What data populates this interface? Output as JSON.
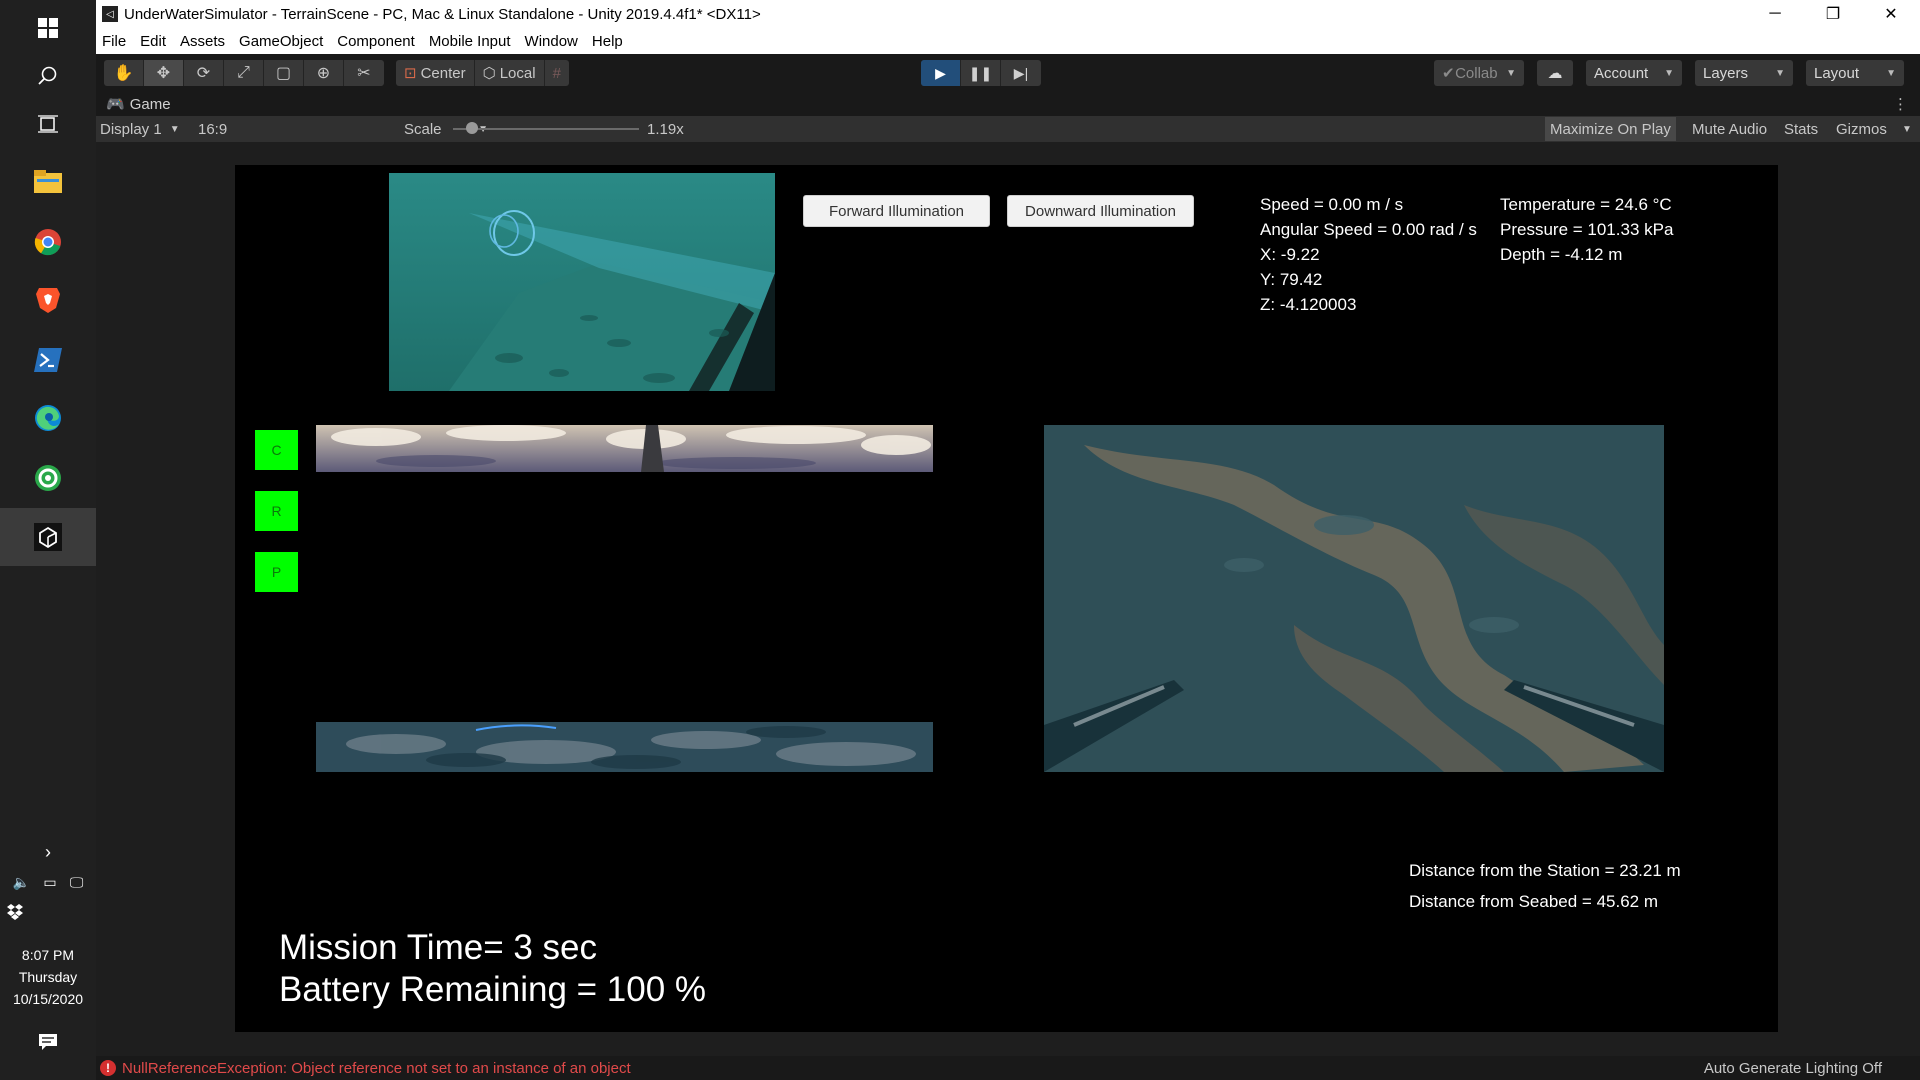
{
  "window": {
    "title": "UnderWaterSimulator - TerrainScene - PC, Mac & Linux Standalone - Unity 2019.4.4f1* <DX11>",
    "controls": {
      "minimize": "─",
      "restore": "❐",
      "close": "✕"
    }
  },
  "menu": [
    "File",
    "Edit",
    "Assets",
    "GameObject",
    "Component",
    "Mobile Input",
    "Window",
    "Help"
  ],
  "toolbar": {
    "tools": [
      "hand-tool",
      "move-tool",
      "rotate-tool",
      "scale-tool",
      "rect-tool",
      "transform-tool",
      "custom-tool"
    ],
    "pivot": "Center",
    "space": "Local",
    "collab": "Collab",
    "account": "Account",
    "layers": "Layers",
    "layout": "Layout"
  },
  "game_tab": {
    "label": "Game"
  },
  "game_controls": {
    "display": "Display 1",
    "aspect": "16:9",
    "scale_label": "Scale",
    "scale_value": "1.19x",
    "scale_fraction": 0.1,
    "maximize": "Maximize On Play",
    "mute": "Mute Audio",
    "stats": "Stats",
    "gizmos": "Gizmos"
  },
  "game": {
    "buttons": {
      "forward": "Forward Illumination",
      "downward": "Downward Illumination"
    },
    "telemetry": {
      "speed": "Speed = 0.00 m / s",
      "angular_speed": "Angular Speed = 0.00 rad / s",
      "x": "X: -9.22",
      "y": "Y: 79.42",
      "z": "Z: -4.120003",
      "temperature": "Temperature = 24.6 °C",
      "pressure": "Pressure = 101.33 kPa",
      "depth": "Depth = -4.12 m"
    },
    "side_buttons": [
      "C",
      "R",
      "P"
    ],
    "distances": {
      "station": "Distance from the Station = 23.21 m",
      "seabed": "Distance from Seabed = 45.62 m"
    },
    "mission_time": "Mission Time= 3 sec",
    "battery": "Battery Remaining = 100 %"
  },
  "status": {
    "error": "NullReferenceException: Object reference not set to an instance of an object",
    "lighting": "Auto Generate Lighting Off"
  },
  "taskbar": {
    "apps": [
      "file-explorer",
      "chrome",
      "brave",
      "powershell",
      "edge",
      "greenshot",
      "unity"
    ],
    "clock_time": "8:07 PM",
    "clock_day": "Thursday",
    "clock_date": "10/15/2020"
  }
}
